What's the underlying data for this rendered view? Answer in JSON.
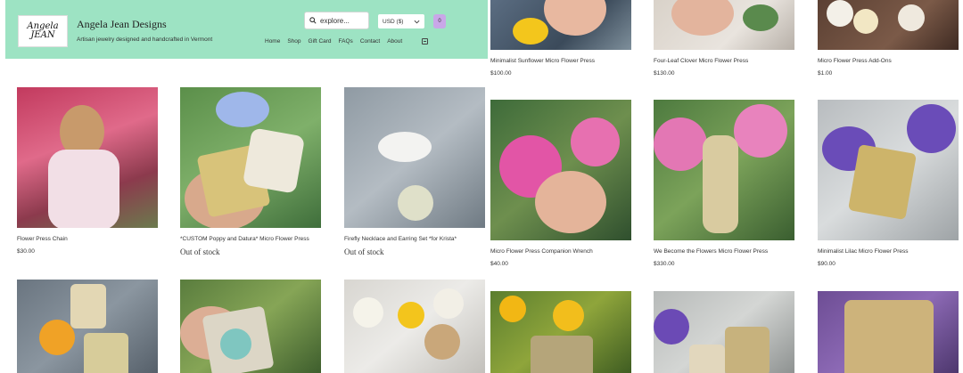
{
  "header": {
    "logo_text": "Angela JEAN",
    "brand": "Angela Jean Designs",
    "tagline": "Artisan jewelry designed and handcrafted in Vermont",
    "search_placeholder": "explore...",
    "currency": "USD ($)",
    "cart_count": "0",
    "nav": [
      "Home",
      "Shop",
      "Gift Card",
      "FAQs",
      "Contact",
      "About"
    ]
  },
  "products": {
    "top": [
      {
        "name": "Minimalist Sunflower Micro Flower Press",
        "price": "$100.00"
      },
      {
        "name": "Four-Leaf Clover Micro Flower Press",
        "price": "$130.00"
      },
      {
        "name": "Micro Flower Press Add-Ons",
        "price": "$1.00"
      }
    ],
    "row1": [
      {
        "name": "Flower Press Chain",
        "price": "$30.00"
      },
      {
        "name": "*CUSTOM Poppy and Datura* Micro Flower Press",
        "status": "Out of stock"
      },
      {
        "name": "Firefly Necklace and Earring Set *for Krista*",
        "status": "Out of stock"
      }
    ],
    "row1b": [
      {
        "name": "Micro Flower Press Companion Wrench",
        "price": "$40.00"
      },
      {
        "name": "We Become the Flowers Micro Flower Press",
        "price": "$330.00"
      },
      {
        "name": "Minimalist Lilac Micro Flower Press",
        "price": "$90.00"
      }
    ]
  },
  "colors": {
    "header_bg": "#9de3c3",
    "cart_bg": "#c9a7e8"
  }
}
